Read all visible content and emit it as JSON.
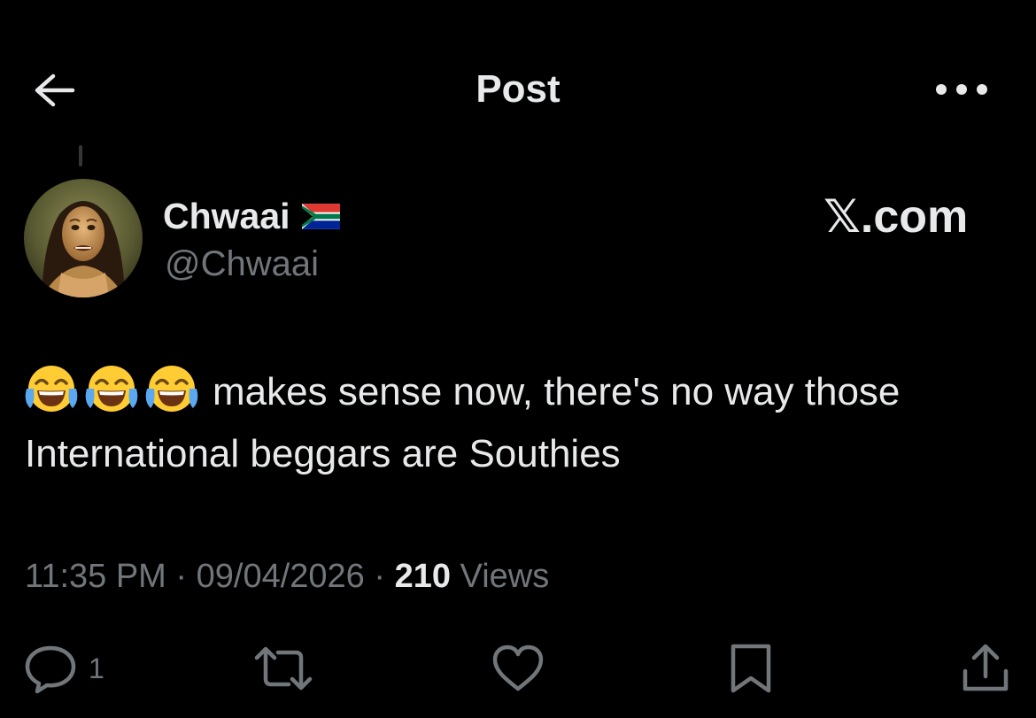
{
  "header": {
    "title": "Post",
    "back_icon": "arrow-left-icon",
    "more_icon": "ellipsis-icon"
  },
  "author": {
    "display_name": "Chwaai",
    "flag_icon": "south-africa-flag-icon",
    "handle": "@Chwaai",
    "avatar": "avatar-image"
  },
  "watermark": "𝕏.com",
  "post": {
    "emoji_icon": "face-with-tears-of-joy-icon",
    "emoji_count": 3,
    "text": "makes sense now, there's no way those International beggars are Southies"
  },
  "meta": {
    "time": "11:35 PM",
    "separator": " · ",
    "date": "09/04/2026",
    "views_count": "210",
    "views_label": " Views"
  },
  "actions": {
    "reply_count": "1",
    "icons": [
      "reply-icon",
      "repost-icon",
      "like-icon",
      "bookmark-icon",
      "share-icon"
    ]
  },
  "colors": {
    "background": "#000000",
    "primary_text": "#e7e9ea",
    "secondary_text": "#71767b"
  }
}
